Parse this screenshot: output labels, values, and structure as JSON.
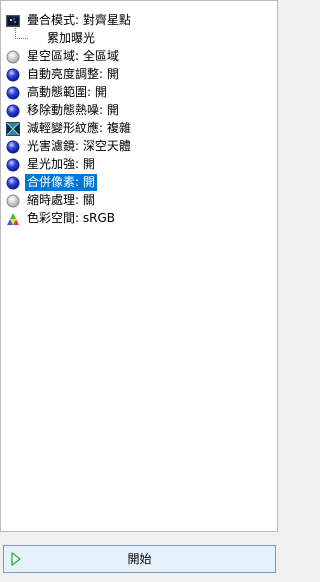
{
  "tree": {
    "items": [
      {
        "label": "疊合模式: 對齊星點",
        "icon": "stack-mode-icon"
      },
      {
        "label": "累加曝光",
        "icon": "tree-connector",
        "child": true
      },
      {
        "label": "星空區域: 全區域",
        "icon": "gray-circle-icon"
      },
      {
        "label": "自動亮度調整: 開",
        "icon": "blue-circle-icon"
      },
      {
        "label": "高動態範圍: 開",
        "icon": "blue-circle-icon"
      },
      {
        "label": "移除動態熱噪: 開",
        "icon": "blue-circle-icon"
      },
      {
        "label": "減輕變形紋應: 複雜",
        "icon": "distortion-icon"
      },
      {
        "label": "光害濾鏡: 深空天體",
        "icon": "blue-circle-icon"
      },
      {
        "label": "星光加強: 開",
        "icon": "blue-circle-icon"
      },
      {
        "label": "合併像素: 開",
        "icon": "blue-circle-icon",
        "selected": true
      },
      {
        "label": "縮時處理: 關",
        "icon": "gray-circle-icon"
      },
      {
        "label": "色彩空間: sRGB",
        "icon": "color-space-icon"
      }
    ]
  },
  "footer": {
    "start_label": "開始",
    "start_icon": "play-icon"
  },
  "colors": {
    "selection": "#0078d7",
    "button_bg": "#e5f1fb",
    "button_border": "#7a9cbf",
    "play_green": "#2fb34a"
  }
}
